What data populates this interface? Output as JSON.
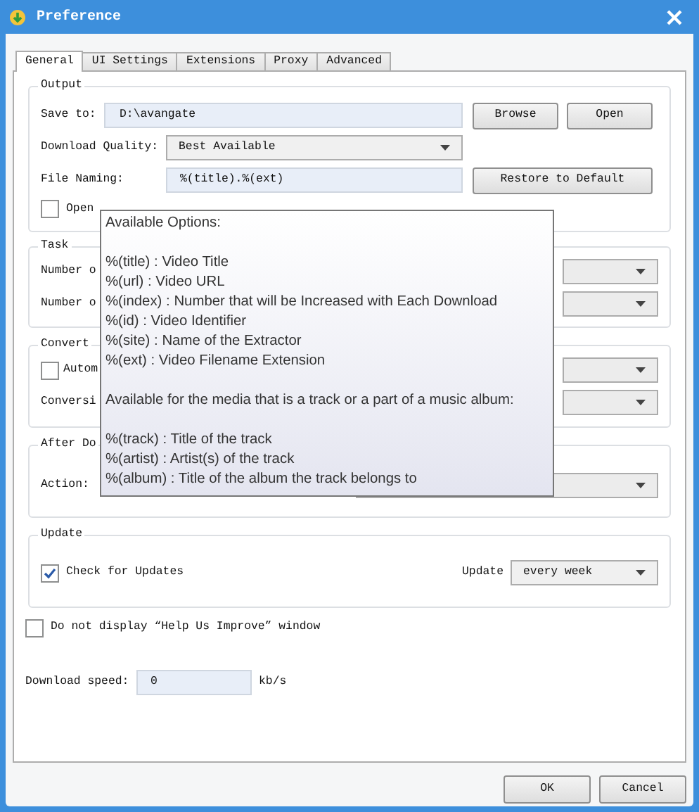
{
  "window": {
    "title": "Preference"
  },
  "tabs": [
    {
      "label": "General",
      "selected": true
    },
    {
      "label": "UI Settings",
      "selected": false
    },
    {
      "label": "Extensions",
      "selected": false
    },
    {
      "label": "Proxy",
      "selected": false
    },
    {
      "label": "Advanced",
      "selected": false
    }
  ],
  "output": {
    "legend": "Output",
    "save_to": {
      "label": "Save to:",
      "value": "D:\\avangate"
    },
    "browse_button": {
      "label": "Browse"
    },
    "open_button": {
      "label": "Open"
    },
    "quality": {
      "label": "Download Quality:",
      "value": "Best Available"
    },
    "naming": {
      "label": "File Naming:",
      "value": "%(title).%(ext)"
    },
    "restore_button": {
      "label": "Restore to Default"
    },
    "open_checkbox": {
      "label": "Open",
      "checked": false
    }
  },
  "task": {
    "legend": "Task",
    "rows": [
      {
        "label": "Number o"
      },
      {
        "label": "Number o"
      }
    ]
  },
  "convert": {
    "legend": "Convert",
    "auto": {
      "label": "Autom",
      "checked": false
    },
    "conversion": {
      "label": "Conversi"
    }
  },
  "after_download": {
    "legend": "After Do",
    "action": {
      "label": "Action:"
    }
  },
  "update": {
    "legend": "Update",
    "check": {
      "label": "Check for Updates",
      "checked": true
    },
    "frequency": {
      "label": "Update",
      "value": "every week"
    }
  },
  "help_checkbox": {
    "label": "Do not display “Help Us Improve” window",
    "checked": false
  },
  "speed": {
    "label": "Download speed:",
    "value": "0",
    "unit": "kb/s"
  },
  "buttons": [
    {
      "label": "OK"
    },
    {
      "label": "Cancel"
    }
  ],
  "tooltip": {
    "paragraphs": [
      {
        "lines": [
          "Available Options:"
        ]
      },
      {
        "lines": [
          "%(title) : Video Title",
          "%(url) : Video URL",
          "%(index) : Number that will be Increased with Each Download",
          "%(id) : Video Identifier",
          "%(site) : Name of the Extractor",
          "%(ext) : Video Filename Extension"
        ]
      },
      {
        "lines": [
          "Available for the media that is a track or a part of a music album:"
        ]
      },
      {
        "lines": [
          "%(track) : Title of the track",
          "%(artist) : Artist(s) of the track",
          "%(album) : Title of the album the track belongs to"
        ]
      }
    ]
  }
}
